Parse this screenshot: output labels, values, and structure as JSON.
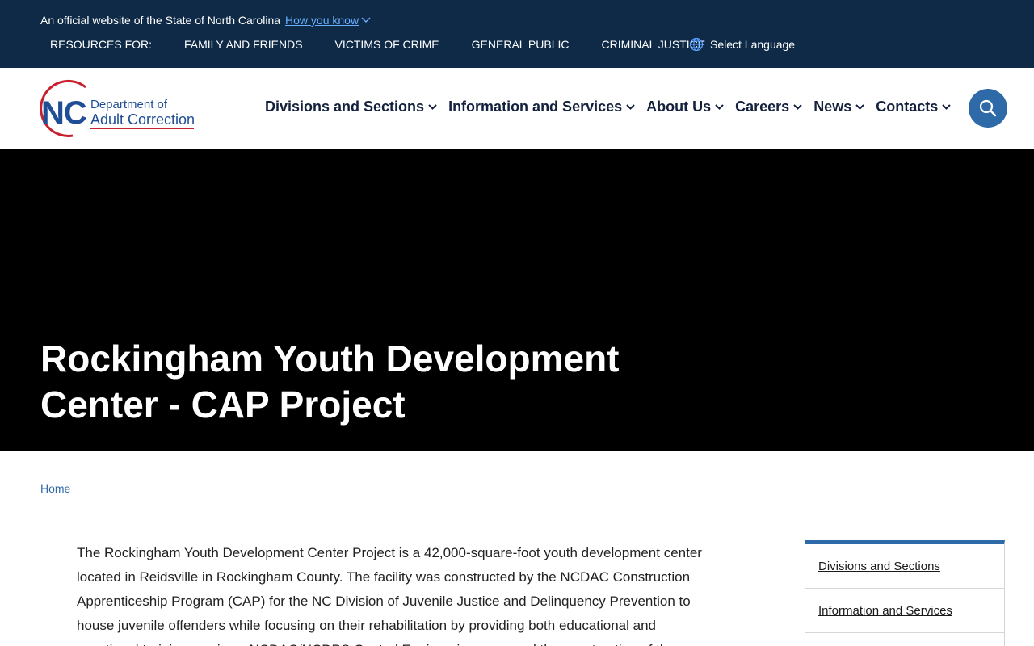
{
  "banner": {
    "official_text": "An official website of the State of North Carolina",
    "how_you_know": "How you know",
    "resources_label": "RESOURCES FOR:",
    "resources": [
      "FAMILY AND FRIENDS",
      "VICTIMS OF CRIME",
      "GENERAL PUBLIC",
      "CRIMINAL JUSTICE"
    ],
    "language": "Select Language"
  },
  "logo": {
    "abbr": "NC",
    "line1": "Department of",
    "line2": "Adult Correction"
  },
  "nav": {
    "items": [
      "Divisions and Sections",
      "Information and Services",
      "About Us",
      "Careers",
      "News",
      "Contacts"
    ]
  },
  "hero": {
    "title": "Rockingham Youth Development Center - CAP Project"
  },
  "breadcrumb": {
    "home": "Home"
  },
  "main": {
    "paragraph": "The Rockingham Youth Development Center Project is a 42,000-square-foot youth development center located in Reidsville in Rockingham County.  The facility was constructed by the NCDAC Construction Apprenticeship Program (CAP) for the NC Division of Juvenile Justice and Delinquency Prevention to house juvenile offenders while focusing on their rehabilitation by providing both educational and vocational training services. NCDAC/NCDPS Central Engineering managed the construction of the"
  },
  "sidebar": {
    "items": [
      "Divisions and Sections",
      "Information and Services",
      ""
    ]
  },
  "colors": {
    "banner_bg": "#0e2a47",
    "accent_blue": "#2f6aa8",
    "logo_blue": "#1f4e96",
    "logo_red": "#c8202f",
    "hero_bg": "#000000"
  },
  "icons": {
    "how_you_know": "chevron-down-icon",
    "language": "globe-icon",
    "nav": "chevron-down-icon",
    "search": "search-icon"
  }
}
